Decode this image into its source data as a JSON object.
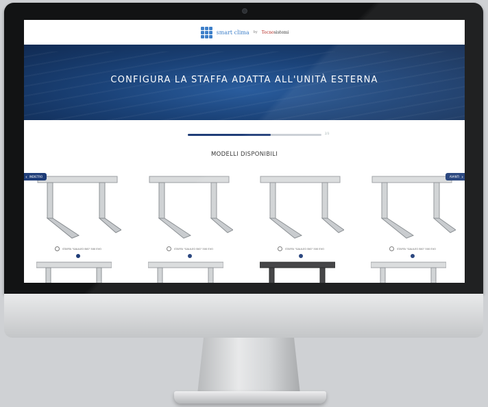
{
  "site": {
    "logo_text": "smart clima",
    "logo_sep": "by",
    "logo_partner_brand": "Tecno",
    "logo_partner_rest": "sistemi",
    "hero_title": "CONFIGURA LA STAFFA ADATTA ALL'UNITÀ ESTERNA",
    "progress": {
      "value": 0.62,
      "label": "2/3"
    },
    "section_title": "MODELLI DISPONIBILI",
    "prev_label": "INDIETRO",
    "next_label": "AVANTI",
    "products": [
      {
        "label": "STAFFA \"GALILEO BIG\" 500 EVO"
      },
      {
        "label": "STAFFA \"GALILEO BIG\" 500 EVO"
      },
      {
        "label": "STAFFA \"GALILEO BIG\" 500 EVO"
      },
      {
        "label": "STAFFA \"GALILEO BIG\" 500 EVO"
      }
    ],
    "colors": {
      "hero": "#1b4379",
      "accent": "#1f3d78",
      "progress_track": "#c9cdd4"
    }
  }
}
